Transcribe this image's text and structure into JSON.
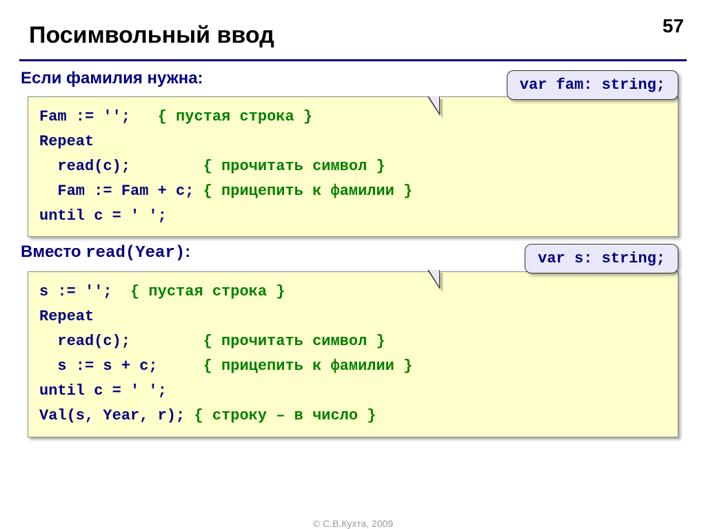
{
  "page_number": "57",
  "title": "Посимвольный ввод",
  "subhead1": "Если фамилия нужна:",
  "callout1": "var fam: string;",
  "code1": {
    "l1a": "Fam := '';   ",
    "l1b": "{ пустая строка }",
    "l2": "Repeat",
    "l3a": "  read(c);        ",
    "l3b": "{ прочитать символ }",
    "l4a": "  Fam := Fam + c; ",
    "l4b": "{ прицепить к фамилии }",
    "l5": "until c = ' ';"
  },
  "subhead2_pre": "Вместо ",
  "subhead2_mono": "read(Year)",
  "subhead2_post": ":",
  "callout2": "var s: string;",
  "code2": {
    "l1a": "s := '';  ",
    "l1b": "{ пустая строка }",
    "l2": "Repeat",
    "l3a": "  read(c);        ",
    "l3b": "{ прочитать символ }",
    "l4a": "  s := s + c;     ",
    "l4b": "{ прицепить к фамилии }",
    "l5": "until c = ' ';",
    "l6a": "Val(s, Year, r); ",
    "l6b": "{ строку – в число }"
  },
  "footer": "© С.В.Кухта, 2009"
}
